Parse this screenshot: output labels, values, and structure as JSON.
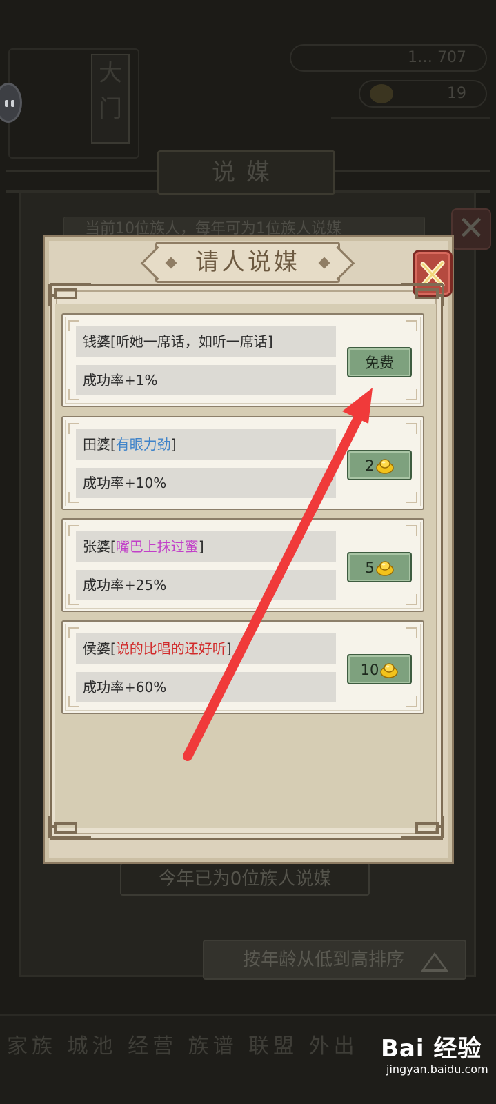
{
  "background": {
    "vertical_sign": "大门",
    "resource_top": "1… 707",
    "resource_second": "19",
    "screen_title": "说媒",
    "info_strip": "当前10位族人，每年可为1位族人说媒",
    "year_status": "今年已为0位族人说媒",
    "sort_button": "按年龄从低到高排序",
    "bottom_bar": "家族 城池 经营 族谱 联盟 外出"
  },
  "modal": {
    "title": "请人说媒",
    "rows": [
      {
        "name": "钱婆",
        "trait": "听她一席话，如听一席话",
        "trait_color": "#2c2c2c",
        "rate": "成功率+1%",
        "cost": "免费",
        "cost_icon": ""
      },
      {
        "name": "田婆",
        "trait": "有眼力劲",
        "trait_color": "#3f83c9",
        "rate": "成功率+10%",
        "cost": "2",
        "cost_icon": "gold-ingot-icon"
      },
      {
        "name": "张婆",
        "trait": "嘴巴上抹过蜜",
        "trait_color": "#c13fc8",
        "rate": "成功率+25%",
        "cost": "5",
        "cost_icon": "gold-ingot-icon"
      },
      {
        "name": "侯婆",
        "trait": "说的比唱的还好听",
        "trait_color": "#d12a2a",
        "rate": "成功率+60%",
        "cost": "10",
        "cost_icon": "gold-ingot-icon"
      }
    ]
  },
  "annotation": {
    "arrow_color": "#f03a3a"
  },
  "watermark": {
    "main": "Bai 经验",
    "sub": "jingyan.baidu.com"
  }
}
